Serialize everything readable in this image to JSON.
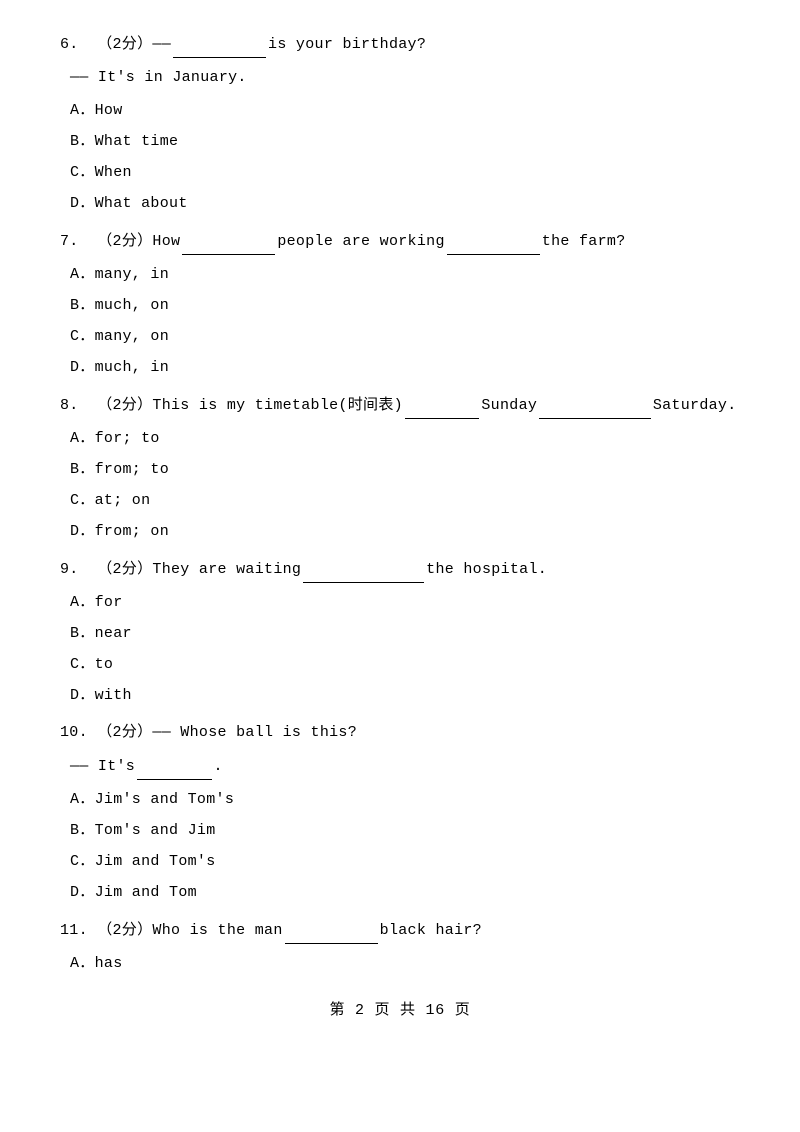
{
  "questions": [
    {
      "number": "6.",
      "marks": "（2分）",
      "text_before_blank": "——",
      "blank": true,
      "text_after_blank": "is your birthday?",
      "answer_line": "—— It's in January.",
      "options": [
        {
          "letter": "A",
          "text": "How"
        },
        {
          "letter": "B",
          "text": "What time"
        },
        {
          "letter": "C",
          "text": "When"
        },
        {
          "letter": "D",
          "text": "What about"
        }
      ]
    },
    {
      "number": "7.",
      "marks": "（2分）",
      "text_before_blank": "How",
      "blank": true,
      "text_middle": "people are working",
      "blank2": true,
      "text_after_blank": "the farm?",
      "answer_line": null,
      "options": [
        {
          "letter": "A",
          "text": "many, in"
        },
        {
          "letter": "B",
          "text": "much, on"
        },
        {
          "letter": "C",
          "text": "many, on"
        },
        {
          "letter": "D",
          "text": "much, in"
        }
      ]
    },
    {
      "number": "8.",
      "marks": "（2分）",
      "text_before_blank": "This is my timetable(时间表)",
      "blank": true,
      "text_middle": "Sunday",
      "blank2": true,
      "text_after_blank": "Saturday.",
      "answer_line": null,
      "options": [
        {
          "letter": "A",
          "text": "for; to"
        },
        {
          "letter": "B",
          "text": "from; to"
        },
        {
          "letter": "C",
          "text": "at; on"
        },
        {
          "letter": "D",
          "text": "from; on"
        }
      ]
    },
    {
      "number": "9.",
      "marks": "（2分）",
      "text_before_blank": "They are waiting",
      "blank": true,
      "text_after_blank": "the hospital.",
      "answer_line": null,
      "options": [
        {
          "letter": "A",
          "text": "for"
        },
        {
          "letter": "B",
          "text": "near"
        },
        {
          "letter": "C",
          "text": "to"
        },
        {
          "letter": "D",
          "text": "with"
        }
      ]
    },
    {
      "number": "10.",
      "marks": "（2分）",
      "text_before_blank": "—— Whose ball is this?",
      "blank": false,
      "text_after_blank": "",
      "answer_line": "—— It's        .",
      "options": [
        {
          "letter": "A",
          "text": "Jim's and Tom's"
        },
        {
          "letter": "B",
          "text": "Tom's and Jim"
        },
        {
          "letter": "C",
          "text": "Jim and Tom's"
        },
        {
          "letter": "D",
          "text": "Jim and Tom"
        }
      ]
    },
    {
      "number": "11.",
      "marks": "（2分）",
      "text_before_blank": "Who is the man",
      "blank": true,
      "text_after_blank": "black hair?",
      "answer_line": null,
      "options": [
        {
          "letter": "A",
          "text": "has"
        }
      ]
    }
  ],
  "footer": {
    "text": "第 2 页 共 16 页"
  }
}
